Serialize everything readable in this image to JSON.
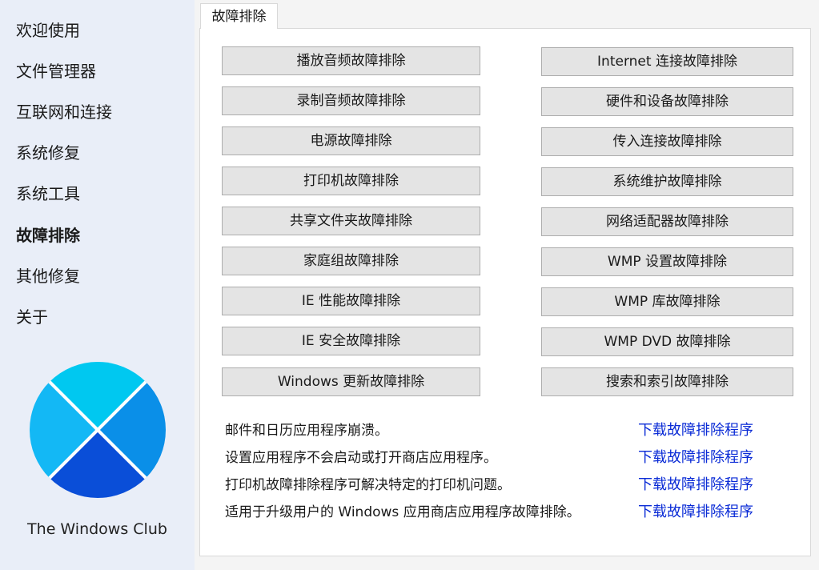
{
  "sidebar": {
    "items": [
      {
        "label": "欢迎使用"
      },
      {
        "label": "文件管理器"
      },
      {
        "label": "互联网和连接"
      },
      {
        "label": "系统修复"
      },
      {
        "label": "系统工具"
      },
      {
        "label": "故障排除",
        "active": true
      },
      {
        "label": "其他修复"
      },
      {
        "label": "关于"
      }
    ],
    "brand": "The Windows Club",
    "logo_colors": [
      "#00c8f0",
      "#0a8fe8",
      "#0a4ed8",
      "#13b8f5"
    ]
  },
  "tab": {
    "label": "故障排除"
  },
  "buttons": {
    "left": [
      "播放音频故障排除",
      "录制音频故障排除",
      "电源故障排除",
      "打印机故障排除",
      "共享文件夹故障排除",
      "家庭组故障排除",
      "IE 性能故障排除",
      "IE 安全故障排除",
      "Windows 更新故障排除"
    ],
    "right": [
      "Internet 连接故障排除",
      "硬件和设备故障排除",
      "传入连接故障排除",
      "系统维护故障排除",
      "网络适配器故障排除",
      "WMP 设置故障排除",
      "WMP 库故障排除",
      "WMP DVD 故障排除",
      "搜索和索引故障排除"
    ]
  },
  "downloads": [
    {
      "text": "邮件和日历应用程序崩溃。",
      "link": "下载故障排除程序"
    },
    {
      "text": "设置应用程序不会启动或打开商店应用程序。",
      "link": "下载故障排除程序"
    },
    {
      "text": "打印机故障排除程序可解决特定的打印机问题。",
      "link": "下载故障排除程序"
    },
    {
      "text": "适用于升级用户的 Windows 应用商店应用程序故障排除。",
      "link": "下载故障排除程序"
    }
  ],
  "colors": {
    "accent_link": "#0a2bd6",
    "sidebar_bg": "#e9eef8",
    "button_bg": "#e4e4e4"
  }
}
